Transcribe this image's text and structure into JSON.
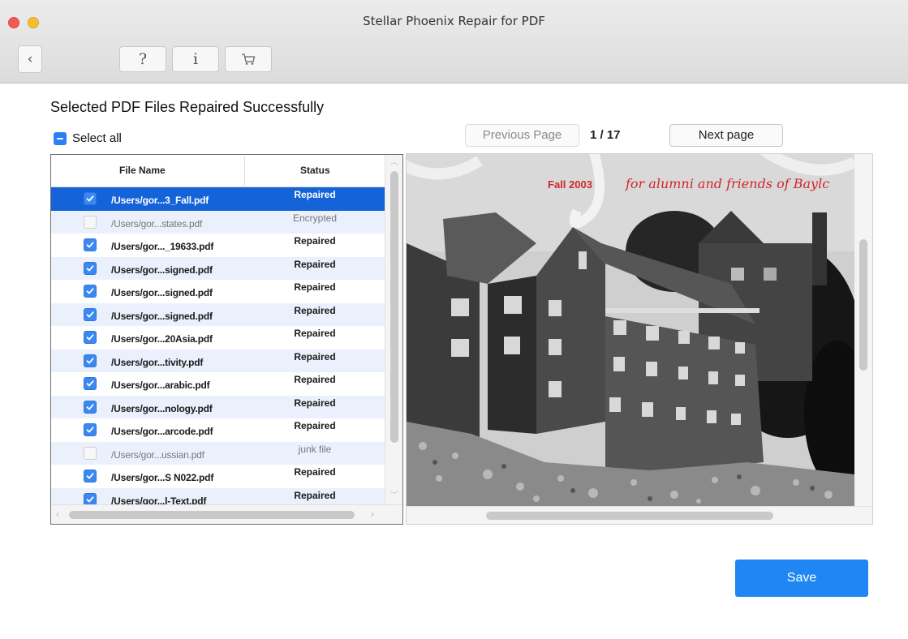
{
  "window": {
    "title": "Stellar Phoenix Repair for PDF",
    "accent": "#1f86f3"
  },
  "toolbar": {
    "back_icon": "chevron-left-icon",
    "help_label": "?",
    "info_label": "i",
    "cart_icon": "cart-icon"
  },
  "main": {
    "heading": "Selected PDF Files Repaired Successfully",
    "select_all_label": "Select all"
  },
  "table": {
    "columns": [
      "File Name",
      "Status"
    ],
    "rows": [
      {
        "checked": true,
        "selected": true,
        "name": "/Users/gor...3_Fall.pdf",
        "status": "Repaired"
      },
      {
        "checked": false,
        "selected": false,
        "name": "/Users/gor...states.pdf",
        "status": "Encrypted"
      },
      {
        "checked": true,
        "selected": false,
        "name": "/Users/gor..._19633.pdf",
        "status": "Repaired"
      },
      {
        "checked": true,
        "selected": false,
        "name": "/Users/gor...signed.pdf",
        "status": "Repaired"
      },
      {
        "checked": true,
        "selected": false,
        "name": "/Users/gor...signed.pdf",
        "status": "Repaired"
      },
      {
        "checked": true,
        "selected": false,
        "name": "/Users/gor...signed.pdf",
        "status": "Repaired"
      },
      {
        "checked": true,
        "selected": false,
        "name": "/Users/gor...20Asia.pdf",
        "status": "Repaired"
      },
      {
        "checked": true,
        "selected": false,
        "name": "/Users/gor...tivity.pdf",
        "status": "Repaired"
      },
      {
        "checked": true,
        "selected": false,
        "name": "/Users/gor...arabic.pdf",
        "status": "Repaired"
      },
      {
        "checked": true,
        "selected": false,
        "name": "/Users/gor...nology.pdf",
        "status": "Repaired"
      },
      {
        "checked": true,
        "selected": false,
        "name": "/Users/gor...arcode.pdf",
        "status": "Repaired"
      },
      {
        "checked": false,
        "selected": false,
        "name": "/Users/gor...ussian.pdf",
        "status": "junk file"
      },
      {
        "checked": true,
        "selected": false,
        "name": "/Users/gor...S N022.pdf",
        "status": "Repaired"
      },
      {
        "checked": true,
        "selected": false,
        "name": "/Users/gor...l-Text.pdf",
        "status": "Repaired"
      }
    ]
  },
  "preview": {
    "prev_label": "Previous Page",
    "page_indicator": "1 / 17",
    "next_label": "Next page",
    "image_text_issue": "Fall 2003",
    "image_text_tagline": "for alumni and friends of Baylc"
  },
  "footer": {
    "save_label": "Save"
  }
}
